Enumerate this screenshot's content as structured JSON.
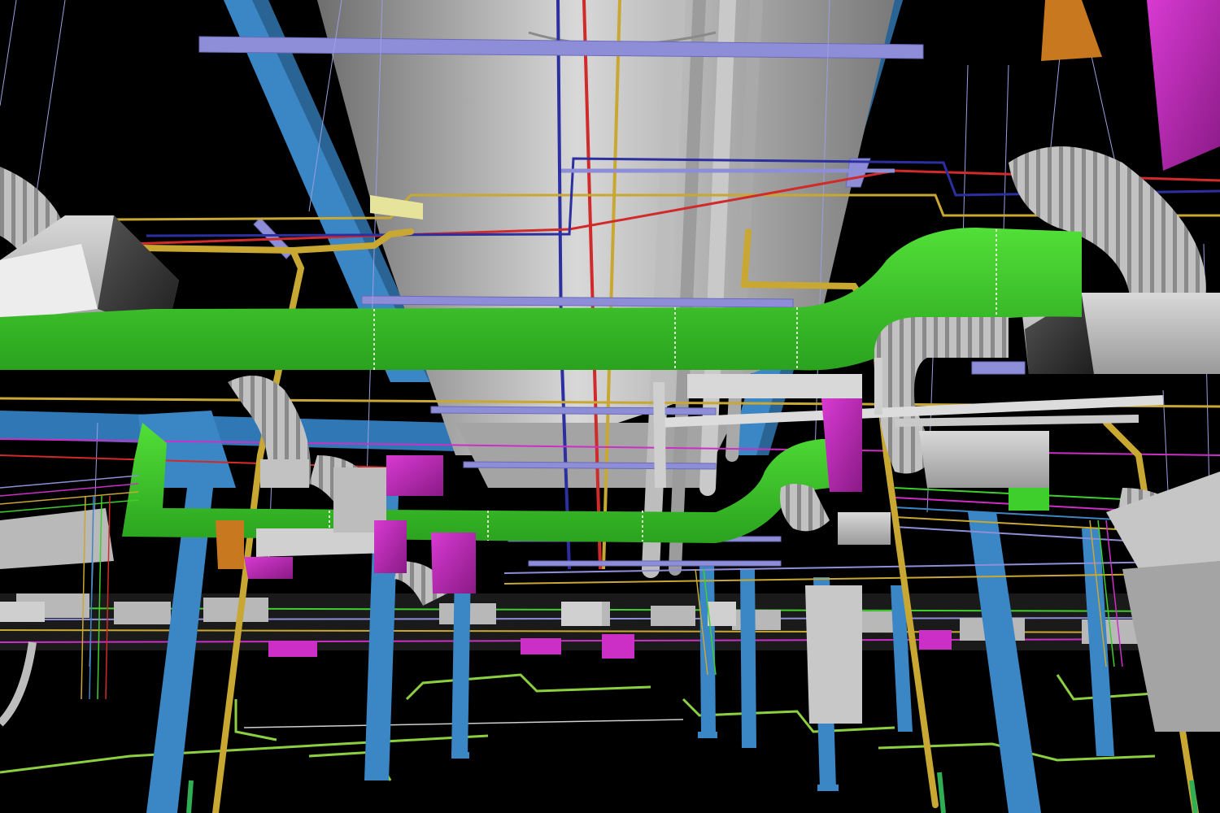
{
  "colors": {
    "background": "#000000",
    "supply_duct": "#3fcf2c",
    "main_duct": "#c9c9c9",
    "steel_beam": "#3b86c4",
    "magenta_equipment": "#cc2fc6",
    "gas_pipe": "#c9a733",
    "hanger_rod": "#8e8ed8",
    "red_pipe": "#d02a2a",
    "navy_pipe": "#2b2fa0",
    "drain_pipe": "#8ccf40",
    "orange_box": "#c8781e"
  },
  "scene": {
    "type": "3d-mep-model-render",
    "icons": [
      "flex-duct-icon",
      "fan-coil-unit-icon",
      "hanger-icon",
      "column-icon"
    ]
  }
}
